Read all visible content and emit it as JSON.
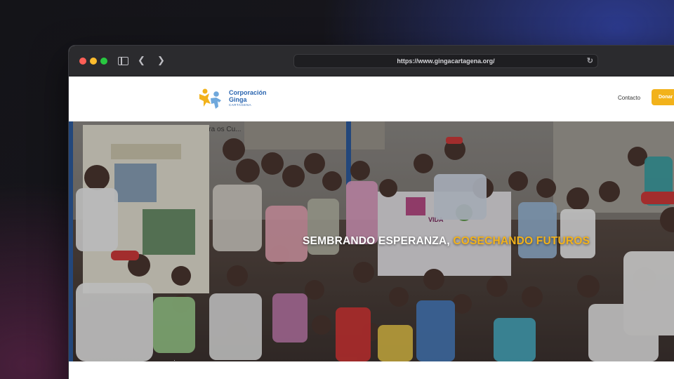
{
  "browser": {
    "url": "https://www.gingacartagena.org/"
  },
  "site": {
    "logo": {
      "name_line1": "Corporación",
      "name_line2": "Ginga",
      "subtitle": "CARTAGENA"
    },
    "nav": {
      "contact_label": "Contacto",
      "donate_label": "Donar"
    },
    "hero": {
      "title_part1": "SEMBRANDO ESPERANZA,",
      "title_part2": "COSECHANDO FUTUROS",
      "banner_text": "VIDA",
      "wall_text": "Llera os Cu..."
    }
  },
  "colors": {
    "accent": "#f2b21b",
    "brand_blue": "#2a65b0"
  }
}
